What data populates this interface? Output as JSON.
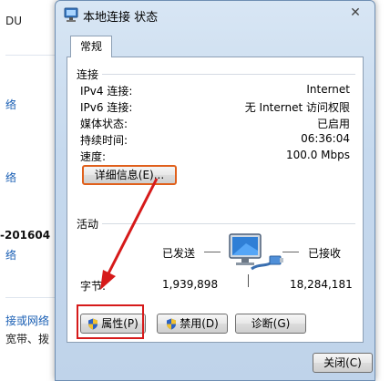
{
  "background_window": {
    "lines": [
      "DU",
      "络",
      "络",
      "-201604",
      "络",
      "接或网络",
      "宽带、拨"
    ]
  },
  "dialog": {
    "title": "本地连接 状态",
    "close_symbol": "✕",
    "tab_general": "常规",
    "connection": {
      "heading": "连接",
      "rows": [
        {
          "label": "IPv4 连接:",
          "value": "Internet"
        },
        {
          "label": "IPv6 连接:",
          "value": "无 Internet 访问权限"
        },
        {
          "label": "媒体状态:",
          "value": "已启用"
        },
        {
          "label": "持续时间:",
          "value": "06:36:04"
        },
        {
          "label": "速度:",
          "value": "100.0 Mbps"
        }
      ],
      "details_button": "详细信息(E)..."
    },
    "activity": {
      "heading": "活动",
      "sent_label": "已发送",
      "received_label": "已接收",
      "bytes_label": "字节:",
      "bytes_sent": "1,939,898",
      "bytes_received": "18,284,181"
    },
    "buttons": {
      "properties": "属性(P)",
      "disable": "禁用(D)",
      "diagnose": "诊断(G)",
      "close": "关闭(C)"
    }
  },
  "colors": {
    "highlight": "#d61a1a",
    "arrow": "#d61a1a",
    "link": "#1a5fb4"
  },
  "icons": {
    "title_icon": "network-adapter-icon",
    "activity_icon": "network-computer-icon",
    "shield": "uac-shield-icon"
  }
}
